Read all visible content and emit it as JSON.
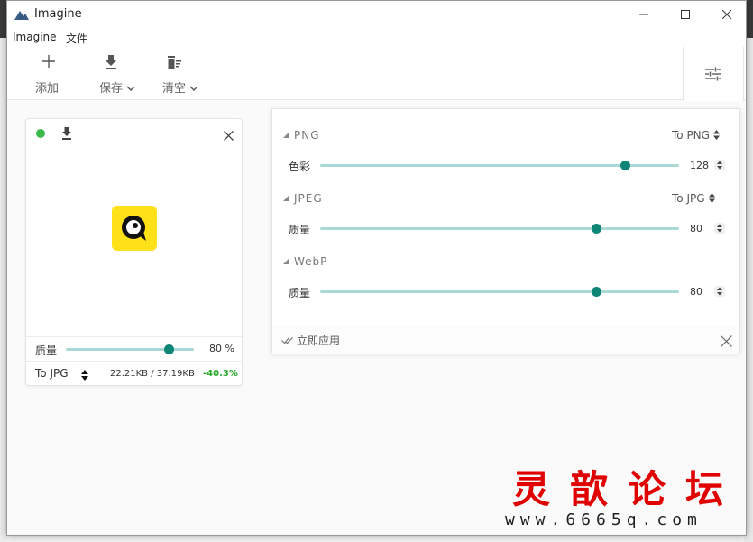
{
  "app": {
    "title": "Imagine"
  },
  "window_controls": {
    "minimize": "minimize",
    "maximize": "maximize",
    "close": "close"
  },
  "menu": {
    "items": [
      "Imagine",
      "文件"
    ]
  },
  "toolbar": {
    "add_label": "添加",
    "save_label": "保存",
    "clear_label": "清空"
  },
  "card": {
    "status_color": "#3cb94a",
    "thumb_color": "#ffe11a",
    "quality_label": "质量",
    "quality_value": 80,
    "quality_text": "80 %",
    "format_label": "To JPG",
    "size_text": "22.21KB / 37.19KB",
    "savings_text": "-40.3%",
    "savings_color": "#29a829"
  },
  "panel": {
    "sections": [
      {
        "title": "PNG",
        "target": "To PNG",
        "row_label": "色彩",
        "value": 128,
        "fraction": 0.85
      },
      {
        "title": "JPEG",
        "target": "To JPG",
        "row_label": "质量",
        "value": 80,
        "fraction": 0.77
      },
      {
        "title": "WebP",
        "target": "",
        "row_label": "质量",
        "value": 80,
        "fraction": 0.77
      }
    ],
    "apply_label": "立即应用"
  },
  "colors": {
    "accent": "#0d8577",
    "track": "#a9d8d7"
  },
  "watermark": {
    "chinese": "灵歆论坛",
    "url": "www.6665q.com"
  }
}
